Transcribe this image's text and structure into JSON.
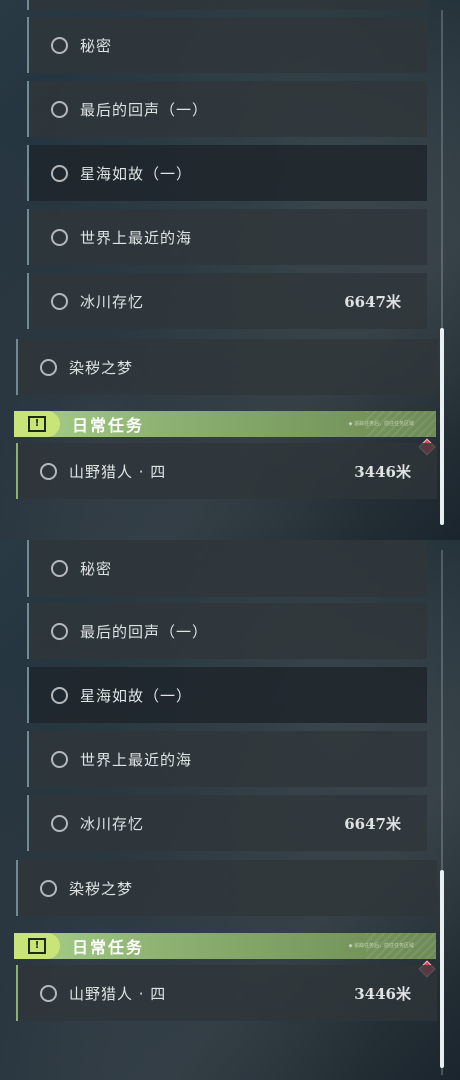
{
  "quests": [
    {
      "label": "秘密",
      "distance": ""
    },
    {
      "label": "最后的回声（一）",
      "distance": ""
    },
    {
      "label": "星海如故（一）",
      "distance": ""
    },
    {
      "label": "世界上最近的海",
      "distance": ""
    },
    {
      "label": "冰川存忆",
      "distance": "6647米"
    },
    {
      "label": "染秽之梦",
      "distance": ""
    }
  ],
  "daily": {
    "title": "日常任务",
    "note": "◆ 追踪任务后，前往任务区域",
    "quest_label": "山野猎人 · 四",
    "quest_distance": "3446米"
  },
  "colors": {
    "accent_green": "#8db272",
    "marker_red": "#e0445a",
    "row_border": "#6f8c96"
  },
  "icons": [
    "circle-icon",
    "alert-icon",
    "diamond-marker-icon"
  ]
}
